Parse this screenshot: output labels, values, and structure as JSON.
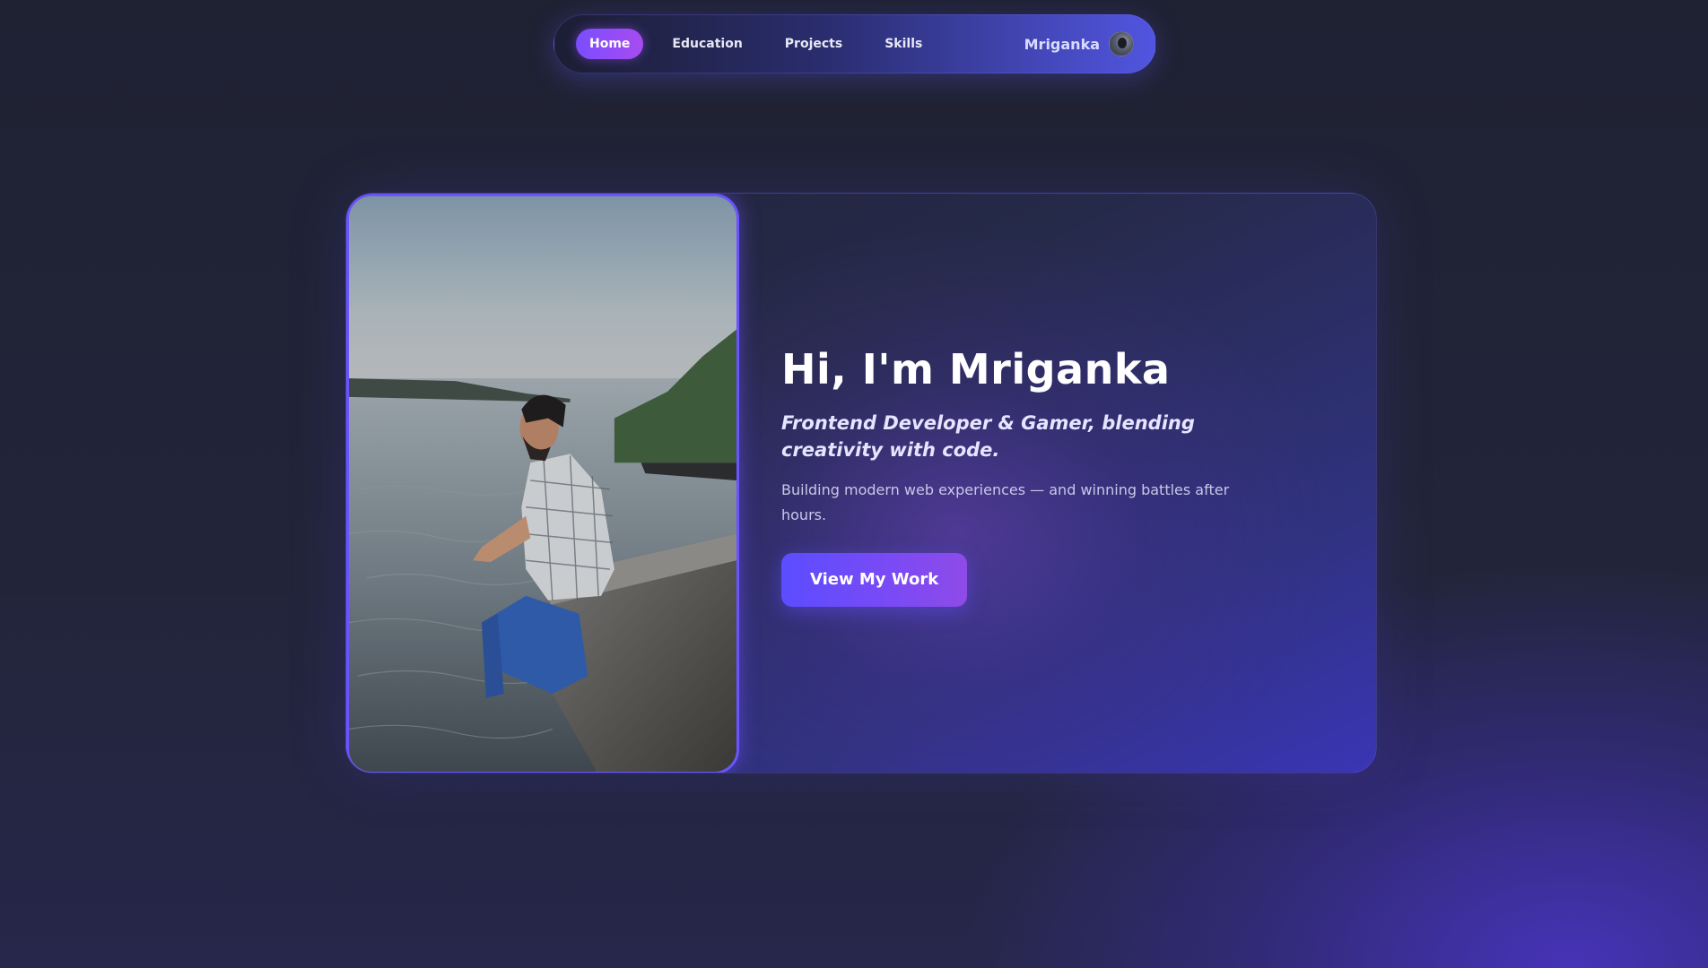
{
  "nav": {
    "items": [
      {
        "label": "Home",
        "active": true
      },
      {
        "label": "Education",
        "active": false
      },
      {
        "label": "Projects",
        "active": false
      },
      {
        "label": "Skills",
        "active": false
      }
    ],
    "brand": "Mriganka",
    "avatar_icon": "avatar-photo"
  },
  "hero": {
    "title": "Hi, I'm Mriganka",
    "subtitle": "Frontend Developer & Gamer, blending creativity with code.",
    "description": "Building modern web experiences — and winning battles after hours.",
    "cta_label": "View My Work"
  },
  "colors": {
    "accent": "#6a54ff",
    "accent_purple": "#a74cf0",
    "background": "#1f2233"
  }
}
